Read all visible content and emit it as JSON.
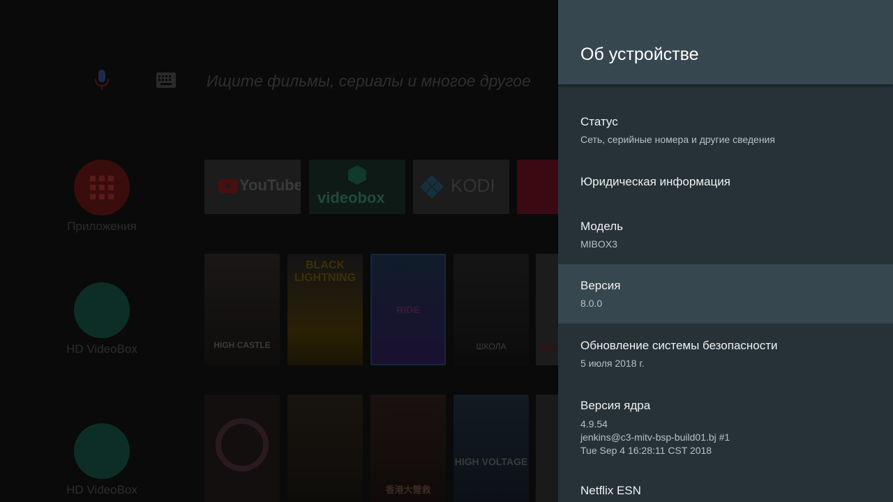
{
  "launcher": {
    "search_placeholder": "Ищите фильмы, сериалы и многое другое",
    "side_apps": [
      {
        "label": "Приложения",
        "icon": "apps-grid-icon"
      },
      {
        "label": "HD VideoBox",
        "icon": "videobox-icon"
      },
      {
        "label": "HD VideoBox",
        "icon": "videobox-icon"
      }
    ],
    "tiles": [
      "YouTube",
      "videobox",
      "KODI"
    ],
    "posters_row1": [
      "HIGH CASTLE",
      "BLACK LIGHTNING",
      "RIDE",
      "ШКОЛА",
      "ДЖ"
    ],
    "posters_row2": [
      "",
      "",
      "香港大營救",
      "HIGH VOLTAGE",
      ""
    ]
  },
  "panel": {
    "title": "Об устройстве",
    "items": [
      {
        "title": "Статус",
        "subtitle": "Сеть, серийные номера и другие сведения"
      },
      {
        "title": "Юридическая информация",
        "subtitle": ""
      },
      {
        "title": "Модель",
        "subtitle": "MIBOX3"
      },
      {
        "title": "Версия",
        "subtitle": "8.0.0"
      },
      {
        "title": "Обновление системы безопасности",
        "subtitle": "5 июля 2018 г."
      },
      {
        "title": "Версия ядра",
        "subtitle": "4.9.54\njenkins@c3-mitv-bsp-build01.bj #1\nTue Sep 4 16:28:11 CST 2018"
      },
      {
        "title": "Netflix ESN",
        "subtitle": ""
      }
    ]
  },
  "colors": {
    "panel_bg": "#263238",
    "header_bg": "#37474f",
    "focused_bg": "#37474f"
  }
}
